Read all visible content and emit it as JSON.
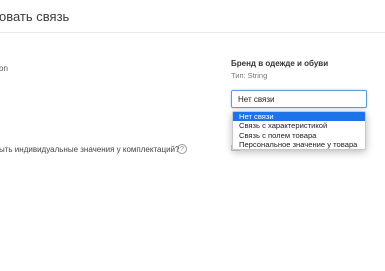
{
  "header": {
    "title": "овать связь"
  },
  "left": {
    "label_fragment": "on"
  },
  "right": {
    "title": "Бренд в одежде и обуви",
    "type_label": "Тип: String"
  },
  "select": {
    "value": "Нет связи",
    "options": [
      {
        "label": "Нет связи",
        "selected": true
      },
      {
        "label": "Связь с характеристикой"
      },
      {
        "label": "Связь с полем товара"
      },
      {
        "label": "Персональное значение у товара"
      }
    ]
  },
  "question": {
    "text": "ыть индивидуальные значения у комплектаций?",
    "help_icon": "?"
  },
  "colors": {
    "accent": "#1e73e8",
    "select_border": "#5b9dd9"
  }
}
